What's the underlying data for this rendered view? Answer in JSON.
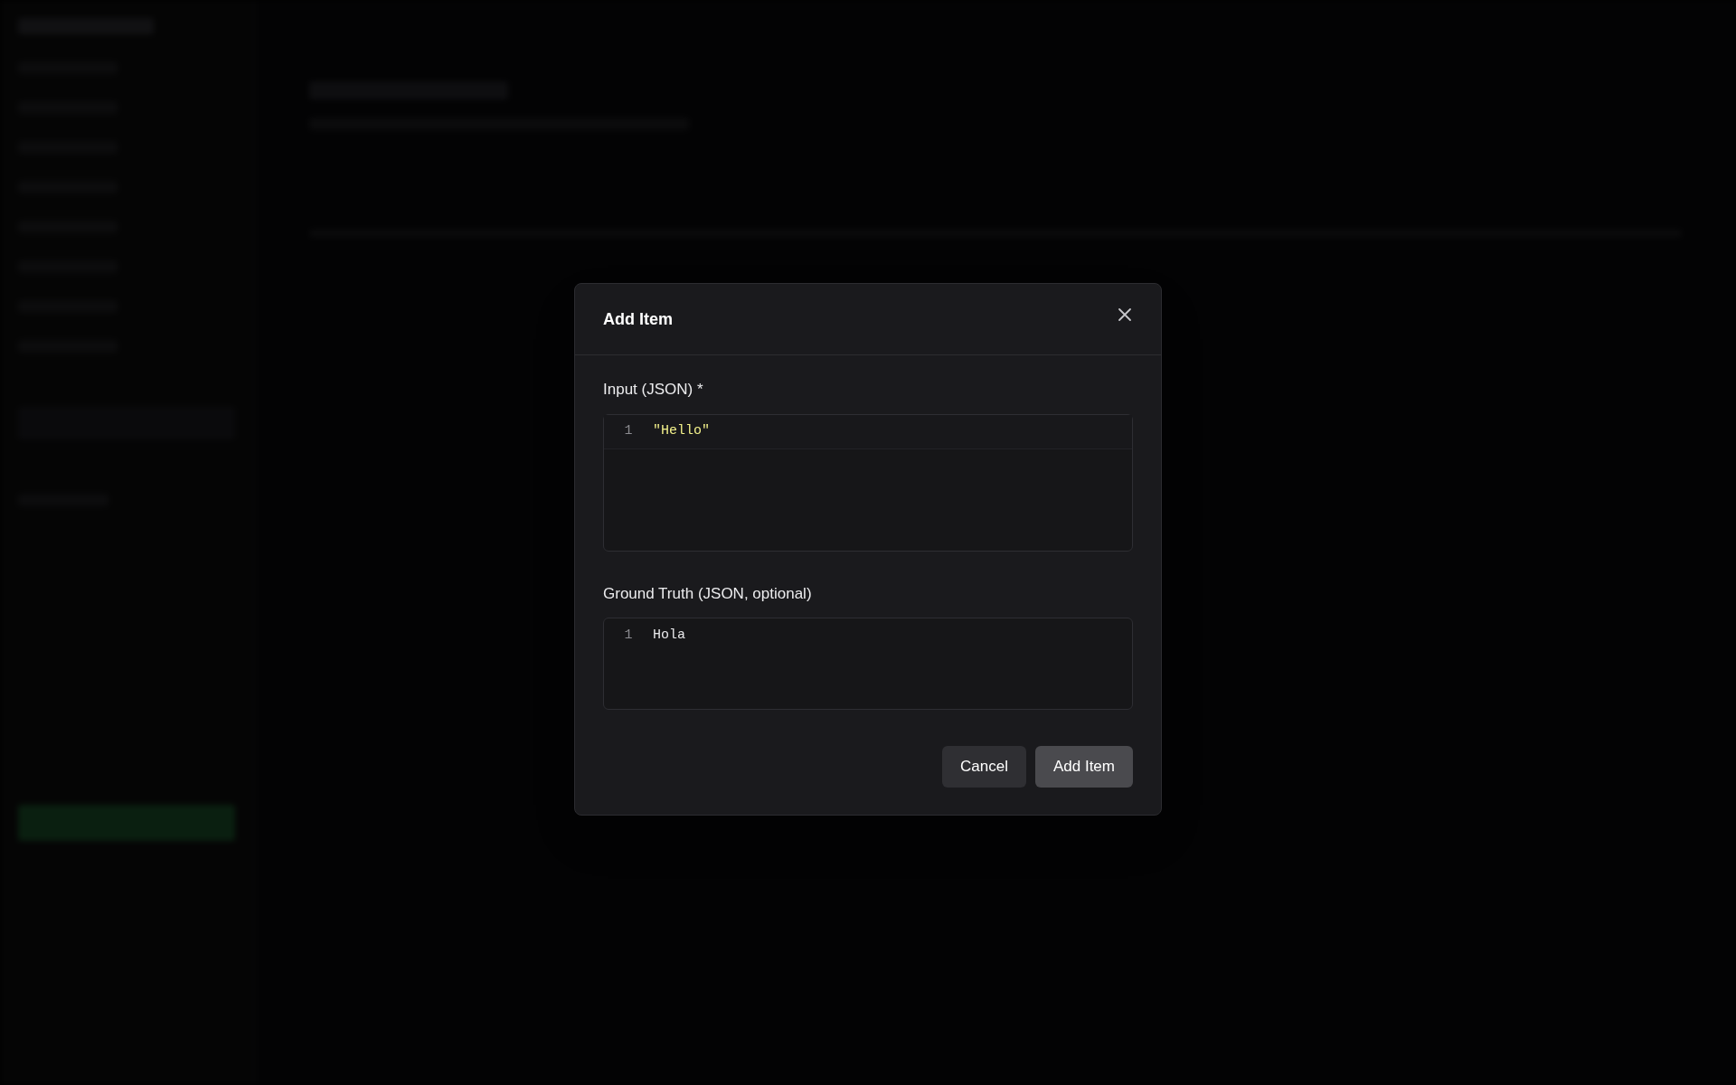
{
  "dialog": {
    "title": "Add Item",
    "fields": [
      {
        "label": "Input (JSON) *",
        "tall": true,
        "lines": [
          {
            "number": "1",
            "text": "\"Hello\"",
            "kind": "string",
            "active": true
          }
        ]
      },
      {
        "label": "Ground Truth (JSON, optional)",
        "tall": false,
        "lines": [
          {
            "number": "1",
            "text": "Hola",
            "kind": "plain",
            "active": false
          }
        ]
      }
    ],
    "buttons": [
      {
        "label": "Cancel",
        "kind": "secondary"
      },
      {
        "label": "Add Item",
        "kind": "primary"
      }
    ]
  }
}
